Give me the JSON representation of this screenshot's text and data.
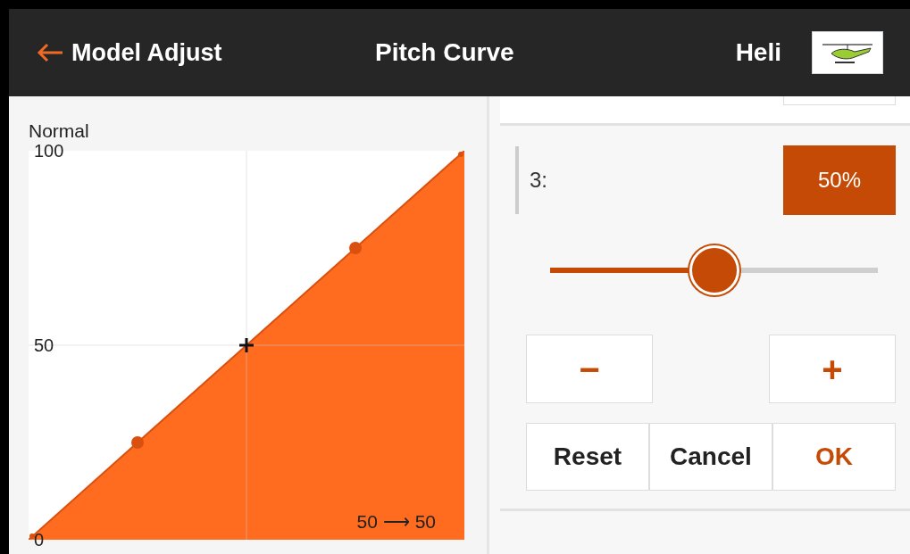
{
  "header": {
    "back_label": "Model Adjust",
    "title": "Pitch Curve",
    "model_type": "Heli"
  },
  "curve": {
    "chart_data": {
      "type": "area",
      "categories": [
        null,
        null,
        null,
        null,
        null
      ],
      "series": [
        {
          "name": "Normal",
          "color": "#ff6b1f",
          "values": [
            0,
            25,
            50,
            75,
            100
          ]
        }
      ],
      "ylim": [
        0,
        100
      ],
      "yticks": [
        0,
        50,
        100
      ]
    },
    "curve_points": [
      {
        "selected": false
      },
      {
        "selected": false
      },
      {
        "selected": true
      },
      {
        "selected": false
      },
      {
        "selected": false
      }
    ],
    "readout": "50 ⟶ 50"
  },
  "editor": {
    "point_label": "3:",
    "point_value": "50%",
    "slider": {
      "level": 0.5
    },
    "step_buttons": [
      "−",
      "+"
    ],
    "actions": [
      {
        "label": "Reset",
        "kind": "plain"
      },
      {
        "label": "Cancel",
        "kind": "plain"
      },
      {
        "label": "OK",
        "kind": "primary"
      }
    ]
  }
}
